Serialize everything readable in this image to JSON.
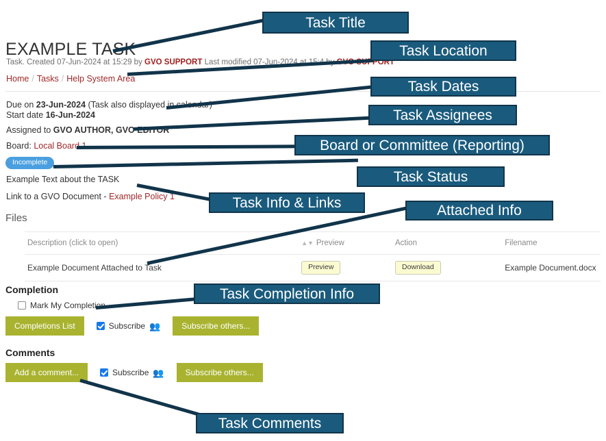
{
  "page": {
    "title": "EXAMPLE TASK",
    "meta": {
      "prefix": "Task. Created 07-Jun-2024 at 15:29 by ",
      "created_by": "GVO SUPPORT",
      "middle": " Last modified 07-Jun-2024 at 15:4",
      "modified_suffix": " by ",
      "modified_by": "GVO SUPPORT"
    },
    "breadcrumb": {
      "home": "Home",
      "tasks": "Tasks",
      "area": "Help System Area",
      "separator": "/"
    }
  },
  "details": {
    "due_prefix": "Due on ",
    "due_date": "23-Jun-2024",
    "due_suffix": " (Task also displayed in calendar)",
    "start_prefix": "Start date ",
    "start_date": "16-Jun-2024",
    "assigned_prefix": "Assigned to ",
    "assignees": "GVO AUTHOR, GVO EDITOR",
    "board_prefix": "Board: ",
    "board_name": "Local Board 1",
    "status": "Incomplete",
    "status_color": "#4a9fe0",
    "task_text": "Example Text about the TASK",
    "link_prefix": "Link to a GVO Document - ",
    "link_text": "Example Policy 1"
  },
  "files": {
    "heading": "Files",
    "sort_icon": "sort-icon",
    "columns": [
      "Description (click to open)",
      "Preview",
      "Action",
      "Filename"
    ],
    "rows": [
      {
        "description": "Example Document Attached to Task",
        "preview_button": "Preview",
        "action_button": "Download",
        "filename": "Example Document.docx"
      }
    ]
  },
  "completion": {
    "heading": "Completion",
    "checkbox_label": "Mark My Completion",
    "checkbox_checked": false,
    "list_button": "Completions List",
    "subscribe_label": "Subscribe",
    "subscribe_checked": true,
    "group_icon": "group-users-icon",
    "subscribe_others_button": "Subscribe others..."
  },
  "comments": {
    "heading": "Comments",
    "add_button": "Add a comment...",
    "subscribe_label": "Subscribe",
    "subscribe_checked": true,
    "group_icon": "group-users-icon",
    "subscribe_others_button": "Subscribe others..."
  },
  "annotations": {
    "accent_fill": "#1a5b7d",
    "accent_border": "#11344a",
    "callouts": [
      {
        "id": "task-title",
        "label": "Task Title"
      },
      {
        "id": "task-location",
        "label": "Task Location"
      },
      {
        "id": "task-dates",
        "label": "Task Dates"
      },
      {
        "id": "task-assignees",
        "label": "Task Assignees"
      },
      {
        "id": "board-committee",
        "label": "Board or Committee (Reporting)"
      },
      {
        "id": "task-status",
        "label": "Task Status"
      },
      {
        "id": "task-info-links",
        "label": "Task Info & Links"
      },
      {
        "id": "attached-info",
        "label": "Attached Info"
      },
      {
        "id": "task-completion",
        "label": "Task Completion Info"
      },
      {
        "id": "task-comments",
        "label": "Task Comments"
      }
    ]
  }
}
